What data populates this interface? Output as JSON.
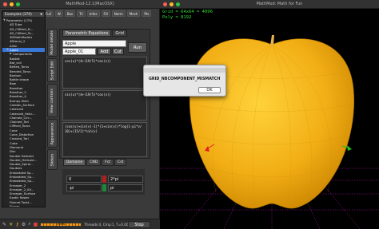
{
  "main_window": {
    "title": "MathMod-12.1(MacOSX)",
    "toolbar": [
      "Full",
      "W",
      "Box",
      "Tri",
      "Infos",
      "Fill",
      "Norm",
      "Mesh",
      "Pts"
    ],
    "examples_label": "Examples (370)",
    "tree": [
      {
        "label": "Parametric (179)",
        "arrow": "▼",
        "indent": 0
      },
      {
        "label": "4D Tube",
        "arrow": "",
        "indent": 1
      },
      {
        "label": "4D_Clifford_N...",
        "arrow": "",
        "indent": 1
      },
      {
        "label": "4D_Clifford_To...",
        "arrow": "",
        "indent": 1
      },
      {
        "label": "4DMathModels",
        "arrow": "",
        "indent": 1
      },
      {
        "label": "4Dtorus_2",
        "arrow": "",
        "indent": 1
      },
      {
        "label": "Alien",
        "arrow": "",
        "indent": 1
      },
      {
        "label": "Apple",
        "arrow": "▼",
        "indent": 1,
        "selected": true
      },
      {
        "label": "Components",
        "arrow": "▶",
        "indent": 2
      },
      {
        "label": "Basket",
        "arrow": "",
        "indent": 1
      },
      {
        "label": "Bat_coil",
        "arrow": "",
        "indent": 1
      },
      {
        "label": "Belted_Torus",
        "arrow": "",
        "indent": 1
      },
      {
        "label": "Bended_Torus",
        "arrow": "",
        "indent": 1
      },
      {
        "label": "Bonbon",
        "arrow": "",
        "indent": 1
      },
      {
        "label": "Bottle shape",
        "arrow": "",
        "indent": 1
      },
      {
        "label": "Bow",
        "arrow": "",
        "indent": 1
      },
      {
        "label": "Breather",
        "arrow": "",
        "indent": 1
      },
      {
        "label": "Breather_2",
        "arrow": "",
        "indent": 1
      },
      {
        "label": "Breather_4",
        "arrow": "",
        "indent": 1
      },
      {
        "label": "Bumpy Klein",
        "arrow": "",
        "indent": 1
      },
      {
        "label": "Catalan_Surface",
        "arrow": "",
        "indent": 1
      },
      {
        "label": "Catenoid",
        "arrow": "",
        "indent": 1
      },
      {
        "label": "Catenoid_Helic...",
        "arrow": "",
        "indent": 1
      },
      {
        "label": "Chained_Circ...",
        "arrow": "",
        "indent": 1
      },
      {
        "label": "Chained_Tori",
        "arrow": "",
        "indent": 1
      },
      {
        "label": "Clifford_Torus",
        "arrow": "",
        "indent": 1
      },
      {
        "label": "Cone",
        "arrow": "",
        "indent": 1
      },
      {
        "label": "Cone_Distortion",
        "arrow": "",
        "indent": 1
      },
      {
        "label": "Crossed_Tori",
        "arrow": "",
        "indent": 1
      },
      {
        "label": "Cube",
        "arrow": "",
        "indent": 1
      },
      {
        "label": "Diamond",
        "arrow": "",
        "indent": 1
      },
      {
        "label": "Dini",
        "arrow": "",
        "indent": 1
      },
      {
        "label": "Double Helicoid",
        "arrow": "",
        "indent": 1
      },
      {
        "label": "Double_Helicoid...",
        "arrow": "",
        "indent": 1
      },
      {
        "label": "Double_Spiral...",
        "arrow": "",
        "indent": 1
      },
      {
        "label": "Doubles",
        "arrow": "",
        "indent": 1
      },
      {
        "label": "Embedded Sp...",
        "arrow": "",
        "indent": 1
      },
      {
        "label": "Embedded_Sp...",
        "arrow": "",
        "indent": 1
      },
      {
        "label": "Embedded_Sp...",
        "arrow": "",
        "indent": 1
      },
      {
        "label": "Enneper_2",
        "arrow": "",
        "indent": 1
      },
      {
        "label": "Enneper_2_KV...",
        "arrow": "",
        "indent": 1
      },
      {
        "label": "Enneper_Surface",
        "arrow": "",
        "indent": 1
      },
      {
        "label": "Exotic flower",
        "arrow": "",
        "indent": 1
      },
      {
        "label": "Fishnet Twist...",
        "arrow": "",
        "indent": 1
      },
      {
        "label": "Flower...",
        "arrow": "",
        "indent": 1
      }
    ],
    "vtabs": [
      "Model details",
      "Script Edit",
      "View controls",
      "Appearance",
      "Sliders"
    ],
    "panel": {
      "tab_parametric": "Parametric Equations",
      "tab_grid": "Grid",
      "name_field": "Apple",
      "component_field": "Apple_01",
      "add_button": "Add",
      "cut_button": "Cut",
      "run_button": "Run",
      "eq_x": "cos(u)*(4+(19/5)*cos(v))",
      "eq_y": "sin(u)*(4+(19/5)*cos(v))",
      "eq_z": "(cos(v)+sin(v)-1)*(1+sin(v))*log(1-pi*v/\n10)+(15/2)*sin(v)",
      "bottom_tabs": [
        "Domaine",
        "CND",
        "Fct",
        "Cst"
      ],
      "u_min": "0",
      "u_max": "2*pi",
      "v_min": "-pi",
      "v_max": "pi"
    },
    "status": {
      "progress_label": "100%",
      "info": "Threads:4, Cmp:1, T=0.00s",
      "stop_button": "Stop"
    }
  },
  "gl_window": {
    "title": "MathMod: Math for Fun",
    "grid_text": "Grid = 64x64 = 4096",
    "poly_text": "Poly = 8192"
  },
  "dialog": {
    "message": "GRID_NBCOMPONENT_MISMATCH",
    "ok_button": "OK"
  },
  "colors": {
    "apple_fill": "#f2ae15",
    "selection": "#3a78d8",
    "hud_text": "#33dd33",
    "floor_grid": "#b01aa8"
  }
}
